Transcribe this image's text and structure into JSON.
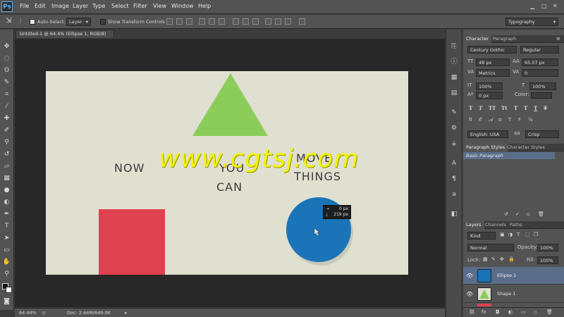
{
  "menubar": {
    "logo": "Ps",
    "items": [
      "File",
      "Edit",
      "Image",
      "Layer",
      "Type",
      "Select",
      "Filter",
      "View",
      "Window",
      "Help"
    ]
  },
  "options": {
    "auto_select_label": "Auto-Select:",
    "auto_select_value": "Layer",
    "show_transform_label": "Show Transform Controls",
    "workspace": "Typography"
  },
  "document": {
    "tab_title": "Untitled-1 @ 64.4% (Ellipse 1, RGB/8) *",
    "words": {
      "now": "NOW",
      "you": "YOU",
      "can": "CAN",
      "move": "MOVE",
      "things": "THINGS"
    },
    "watermark": "www.cgtsj.com",
    "tooltip": {
      "dx": "0 px",
      "dy": "219 px"
    },
    "colors": {
      "background": "#dfe0d0",
      "triangle": "#8ccc5a",
      "square": "#e04150",
      "circle": "#1a74b7"
    }
  },
  "status": {
    "zoom": "64.44%",
    "doc": "Doc: 2.64M/649.0K"
  },
  "character_panel": {
    "tabs": [
      "Character",
      "Paragraph"
    ],
    "font_family": "Century Gothic",
    "font_style": "Regular",
    "font_size": "48 px",
    "leading": "65.07 px",
    "kerning": "Metrics",
    "tracking": "0",
    "vertical_scale": "100%",
    "horizontal_scale": "100%",
    "baseline_shift": "0 px",
    "color_label": "Color:",
    "glyphs": [
      "T",
      "T",
      "TT",
      "Tt",
      "T",
      "T",
      "T",
      "T"
    ],
    "language": "English: USA",
    "aa_label": "aa",
    "antialias": "Crisp"
  },
  "styles_panel": {
    "tabs": [
      "Paragraph Styles",
      "Character Styles"
    ],
    "item": "Basic Paragraph"
  },
  "layers_panel": {
    "tabs": [
      "Layers",
      "Channels",
      "Paths"
    ],
    "filter": "Kind",
    "blend_mode": "Normal",
    "opacity_label": "Opacity:",
    "opacity": "100%",
    "lock_label": "Lock:",
    "fill_label": "Fill:",
    "fill": "100%",
    "layers": [
      {
        "name": "Ellipse 1",
        "selected": true
      },
      {
        "name": "Shape 1",
        "selected": false
      }
    ]
  }
}
